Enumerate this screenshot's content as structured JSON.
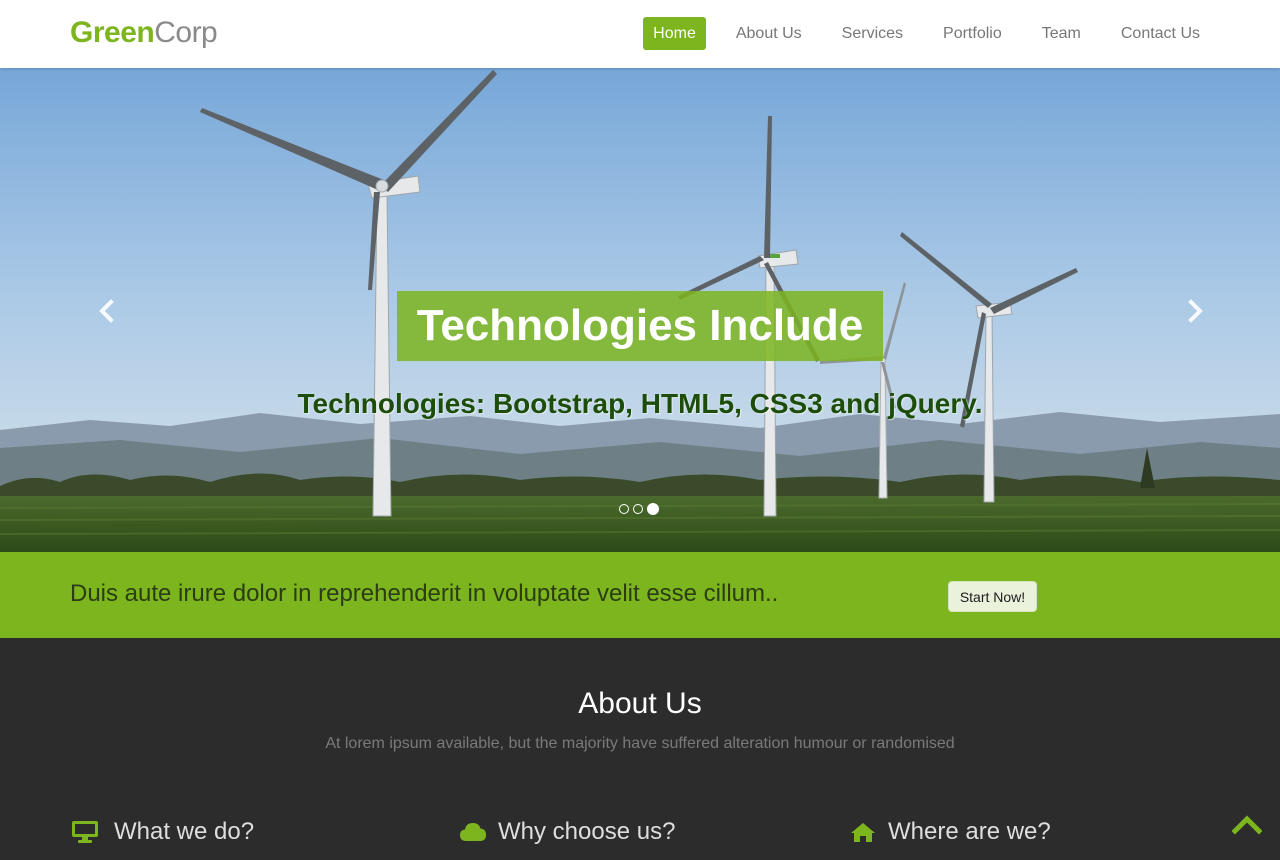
{
  "brand": {
    "part1": "Green",
    "part2": "Corp"
  },
  "nav": {
    "items": [
      {
        "label": "Home",
        "active": true
      },
      {
        "label": "About Us",
        "active": false
      },
      {
        "label": "Services",
        "active": false
      },
      {
        "label": "Portfolio",
        "active": false
      },
      {
        "label": "Team",
        "active": false
      },
      {
        "label": "Contact Us",
        "active": false
      }
    ]
  },
  "hero": {
    "title": "Technologies Include",
    "subtitle": "Technologies: Bootstrap, HTML5, CSS3 and jQuery.",
    "prev_icon": "chevron-left-icon",
    "next_icon": "chevron-right-icon",
    "slide_count": 3,
    "active_slide": 3
  },
  "cta": {
    "text": "Duis aute irure dolor in reprehenderit in voluptate velit esse cillum..",
    "button_label": "Start Now!"
  },
  "about": {
    "title": "About Us",
    "subtitle": "At lorem ipsum available, but the majority have suffered alteration humour or randomised",
    "features": [
      {
        "icon": "desktop-icon",
        "title": "What we do?"
      },
      {
        "icon": "cloud-icon",
        "title": "Why choose us?"
      },
      {
        "icon": "home-icon",
        "title": "Where are we?"
      }
    ]
  },
  "scroll_top_icon": "chevron-up-icon",
  "colors": {
    "accent": "#7db51e",
    "dark": "#2c2c2c",
    "caption_text": "#1d4d0b"
  }
}
